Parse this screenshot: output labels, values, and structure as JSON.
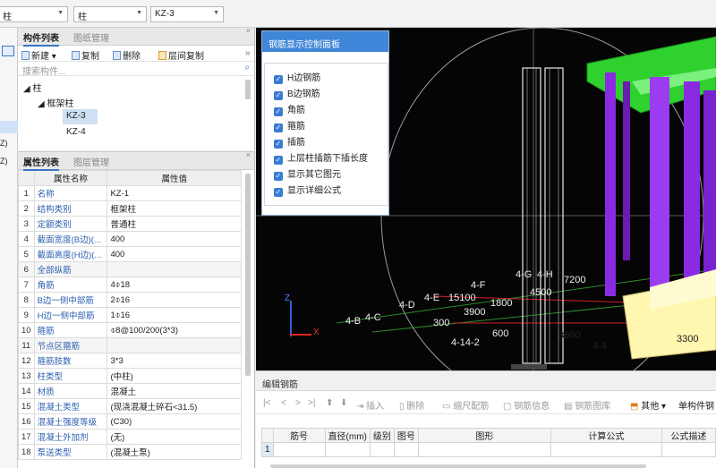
{
  "topbar": {
    "combo1": "柱",
    "combo2": "柱",
    "combo3": "KZ-3"
  },
  "left_strip": {
    "labels": [
      "Z)",
      "Z)"
    ]
  },
  "component_panel": {
    "tabs": [
      "构件列表",
      "图纸管理"
    ],
    "toolbar": {
      "new_label": "新建",
      "copy_label": "复制",
      "delete_label": "删除",
      "layer_copy_label": "层间复制"
    },
    "search_placeholder": "搜索构件...",
    "tree": {
      "root": "柱",
      "group": "框架柱",
      "items": [
        "KZ-3",
        "KZ-4"
      ]
    }
  },
  "property_panel": {
    "tabs": [
      "属性列表",
      "图层管理"
    ],
    "headers": [
      "属性名称",
      "属性值"
    ],
    "rows": [
      {
        "n": "1",
        "k": "名称",
        "v": "KZ-1"
      },
      {
        "n": "2",
        "k": "结构类别",
        "v": "框架柱"
      },
      {
        "n": "3",
        "k": "定额类别",
        "v": "普通柱"
      },
      {
        "n": "4",
        "k": "截面宽度(B边)(...",
        "v": "400"
      },
      {
        "n": "5",
        "k": "截面高度(H边)(...",
        "v": "400"
      },
      {
        "n": "6",
        "k": "全部纵筋",
        "v": ""
      },
      {
        "n": "7",
        "k": "角筋",
        "v": "4⌽18"
      },
      {
        "n": "8",
        "k": "B边一侧中部筋",
        "v": "2⌽16"
      },
      {
        "n": "9",
        "k": "H边一侧中部筋",
        "v": "1⌽16"
      },
      {
        "n": "10",
        "k": "箍筋",
        "v": "⌽8@100/200(3*3)"
      },
      {
        "n": "11",
        "k": "节点区箍筋",
        "v": ""
      },
      {
        "n": "12",
        "k": "箍筋肢数",
        "v": "3*3"
      },
      {
        "n": "13",
        "k": "柱类型",
        "v": "(中柱)"
      },
      {
        "n": "14",
        "k": "材质",
        "v": "混凝土"
      },
      {
        "n": "15",
        "k": "混凝土类型",
        "v": "(现浇混凝土碎石<31.5)"
      },
      {
        "n": "16",
        "k": "混凝土强度等级",
        "v": "(C30)"
      },
      {
        "n": "17",
        "k": "混凝土外加剂",
        "v": "(无)"
      },
      {
        "n": "18",
        "k": "泵送类型",
        "v": "(混凝土泵)"
      }
    ]
  },
  "rebar_panel": {
    "title": "钢筋显示控制面板",
    "options": [
      "H边钢筋",
      "B边钢筋",
      "角筋",
      "箍筋",
      "插筋",
      "上层柱插筋下插长度",
      "显示其它图元",
      "显示详细公式"
    ]
  },
  "viewport": {
    "labels": [
      "4-H",
      "4-G",
      "4-F",
      "4-E",
      "4-D",
      "4-C",
      "4-B",
      "15100",
      "3900",
      "1800",
      "4500",
      "7200",
      "300",
      "4-14-2",
      "600",
      "3600",
      "4-4",
      "3300"
    ],
    "axis_z": "Z",
    "axis_x": "X"
  },
  "edit_rebar": {
    "title": "编辑钢筋",
    "toolbar": {
      "first": "|<",
      "prev": "<",
      "next": ">",
      "last": ">|",
      "insert": "插入",
      "delete": "删除",
      "scale": "缩尺配筋",
      "info": "钢筋信息",
      "library": "钢筋图库",
      "other": "其他",
      "single": "单构件钢"
    },
    "columns": [
      "筋号",
      "直径(mm)",
      "级别",
      "图号",
      "图形",
      "计算公式",
      "公式描述"
    ],
    "row_number": "1"
  },
  "colors": {
    "accent": "#3f86d8",
    "beam_green": "#2fd12f",
    "column_purple": "#8a2be2",
    "slab_yellow": "#fff6b0"
  }
}
